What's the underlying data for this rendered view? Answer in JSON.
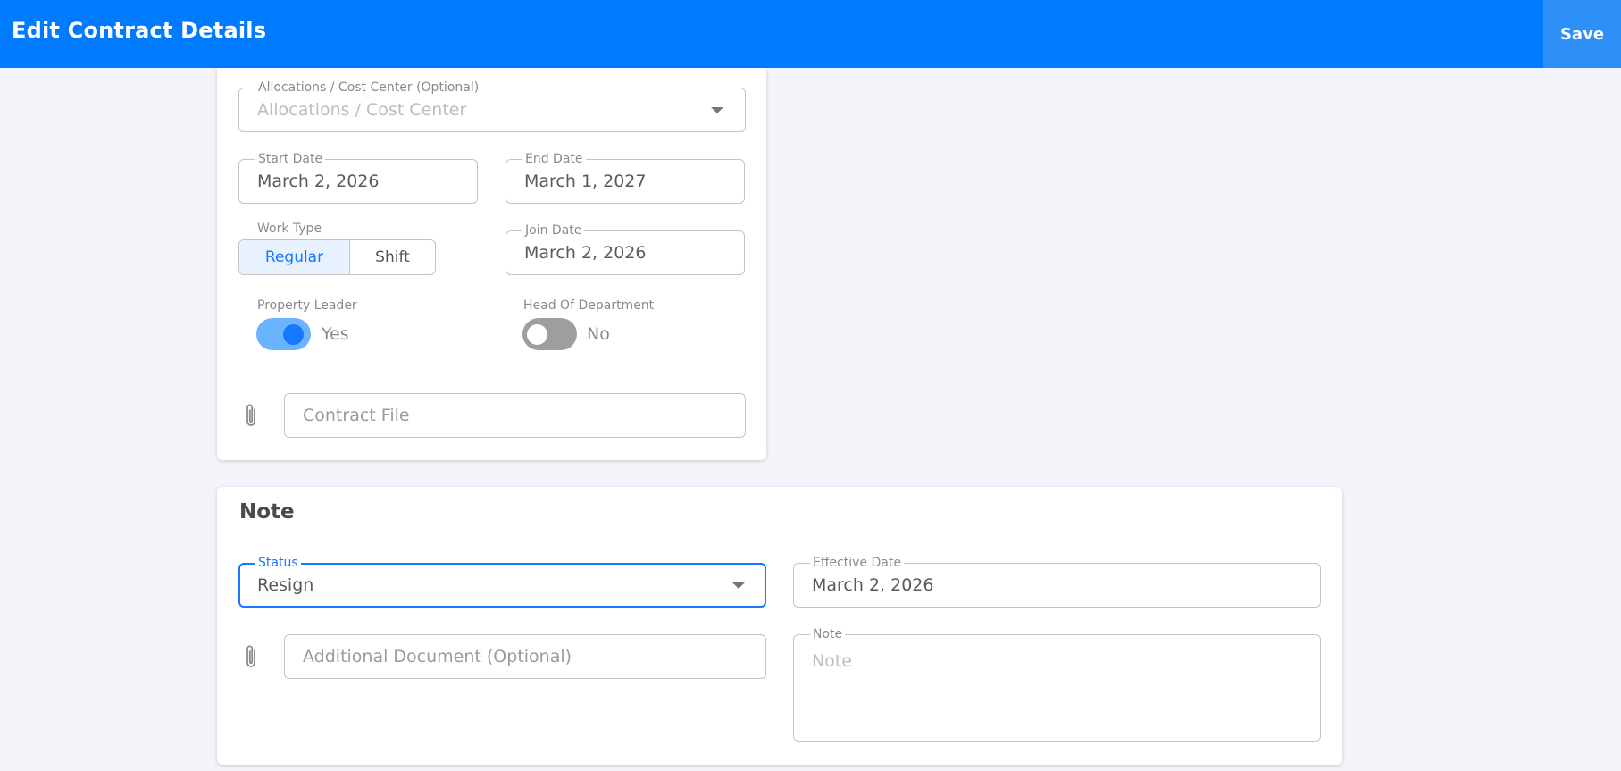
{
  "header": {
    "title": "Edit Contract Details",
    "save_label": "Save"
  },
  "contract": {
    "allocations": {
      "label": "Allocations / Cost Center (Optional)",
      "placeholder": "Allocations / Cost Center"
    },
    "start_date": {
      "label": "Start Date",
      "value": "March 2, 2026"
    },
    "end_date": {
      "label": "End Date",
      "value": "March 1, 2027"
    },
    "work_type": {
      "label": "Work Type",
      "options": [
        "Regular",
        "Shift"
      ],
      "selected": "Regular"
    },
    "join_date": {
      "label": "Join Date",
      "value": "March 2, 2026"
    },
    "property_leader": {
      "label": "Property Leader",
      "state": "Yes",
      "on": true
    },
    "head_of_department": {
      "label": "Head Of Department",
      "state": "No",
      "on": false
    },
    "contract_file": {
      "placeholder": "Contract File"
    }
  },
  "note_section": {
    "title": "Note",
    "status": {
      "label": "Status",
      "value": "Resign"
    },
    "effective_date": {
      "label": "Effective Date",
      "value": "March 2, 2026"
    },
    "additional_document": {
      "placeholder": "Additional Document (Optional)"
    },
    "note": {
      "label": "Note",
      "placeholder": "Note"
    }
  },
  "colors": {
    "header": "#007bff",
    "accent": "#1677ff",
    "background": "#f3f4f9"
  },
  "icons": {
    "attachment": "paperclip-icon",
    "dropdown": "chevron-down-icon"
  }
}
